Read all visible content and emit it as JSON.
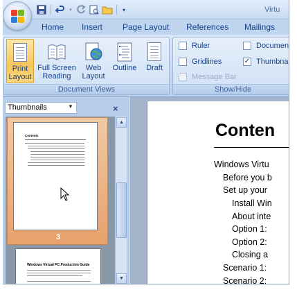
{
  "title_bar": {
    "title": "Virtu"
  },
  "quick_access": {
    "items": [
      "save-icon",
      "undo-icon",
      "undo-dropdown-icon",
      "redo-icon",
      "print-preview-icon",
      "folder-icon",
      "customize-dropdown-icon"
    ]
  },
  "ribbon_tabs": [
    "Home",
    "Insert",
    "Page Layout",
    "References",
    "Mailings"
  ],
  "document_views": {
    "label": "Document Views",
    "buttons": [
      {
        "line1": "Print",
        "line2": "Layout",
        "active": true
      },
      {
        "line1": "Full Screen",
        "line2": "Reading",
        "active": false
      },
      {
        "line1": "Web",
        "line2": "Layout",
        "active": false
      },
      {
        "line1": "Outline",
        "line2": "",
        "active": false
      },
      {
        "line1": "Draft",
        "line2": "",
        "active": false
      }
    ]
  },
  "show_hide": {
    "label": "Show/Hide",
    "ruler": {
      "label": "Ruler",
      "checked": false
    },
    "gridlines": {
      "label": "Gridlines",
      "checked": false
    },
    "message_bar": {
      "label": "Message Bar",
      "checked": false,
      "enabled": false
    },
    "document_map": {
      "label": "Documen",
      "checked": false
    },
    "thumbnails": {
      "label": "Thumbna",
      "checked": true
    }
  },
  "side_pane": {
    "selected": "Thumbnails",
    "close_glyph": "×",
    "thumbnails": [
      {
        "page_number": "3",
        "selected": true,
        "heading": "Contents"
      },
      {
        "page_number": "",
        "selected": false,
        "heading": "Windows Virtual PC Production Guide"
      }
    ]
  },
  "document": {
    "heading": "Conten",
    "toc": [
      {
        "text": "Windows Virtu",
        "level": 0
      },
      {
        "text": "Before you b",
        "level": 1
      },
      {
        "text": "Set up your",
        "level": 1
      },
      {
        "text": "Install Win",
        "level": 2
      },
      {
        "text": "About inte",
        "level": 2
      },
      {
        "text": "Option 1:",
        "level": 2
      },
      {
        "text": "Option 2:",
        "level": 2
      },
      {
        "text": "Closing a",
        "level": 2
      },
      {
        "text": "Scenario 1:",
        "level": 1
      },
      {
        "text": "Scenario 2:",
        "level": 1
      }
    ]
  },
  "colors": {
    "accent": "#15428b",
    "ribbon": "#c5d9f1",
    "active_button": "#f8c65a",
    "thumbnail_highlight": "#e8a16b"
  }
}
